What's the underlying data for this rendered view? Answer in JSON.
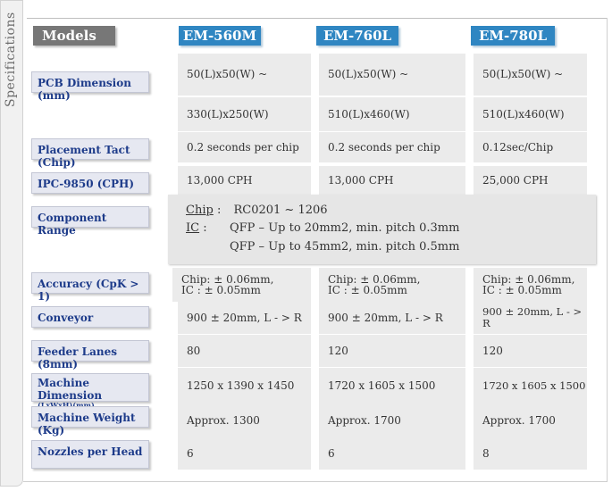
{
  "side_label": "Specifications",
  "models_label": "Models",
  "models": [
    "EM-560M",
    "EM-760L",
    "EM-780L"
  ],
  "rows": [
    {
      "label": "PCB Dimension (mm)",
      "values": [
        "50(L)x50(W) ~",
        "50(L)x50(W) ~",
        "50(L)x50(W) ~"
      ]
    },
    {
      "label": "",
      "values": [
        "330(L)x250(W)",
        "510(L)x460(W)",
        "510(L)x460(W)"
      ]
    },
    {
      "label": "Placement Tact (Chip)",
      "values": [
        "0.2 seconds per chip",
        "0.2 seconds per chip",
        "0.12sec/Chip"
      ]
    },
    {
      "label": "IPC-9850 (CPH)",
      "values": [
        "13,000 CPH",
        "13,000 CPH",
        "25,000 CPH"
      ]
    },
    {
      "label": "Component Range"
    },
    {
      "label": "Accuracy (CpK > 1)",
      "values": [
        [
          "Chip: ± 0.06mm,",
          "IC : ± 0.05mm"
        ],
        [
          "Chip: ± 0.06mm,",
          "IC : ± 0.05mm"
        ],
        [
          "Chip: ± 0.06mm,",
          "IC : ± 0.05mm"
        ]
      ]
    },
    {
      "label": "Conveyor",
      "values": [
        "900 ± 20mm, L - > R",
        "900 ± 20mm, L - > R",
        "900 ± 20mm, L - > R"
      ]
    },
    {
      "label": "Feeder Lanes (8mm)",
      "values": [
        "80",
        "120",
        "120"
      ]
    },
    {
      "label": "Machine Dimension",
      "sublabel": "(LxWxH)(mm)",
      "values": [
        "1250 x 1390 x 1450",
        "1720 x 1605 x 1500",
        "1720 x 1605 x 1500"
      ]
    },
    {
      "label": "Machine Weight (Kg)",
      "values": [
        "Approx. 1300",
        "Approx. 1700",
        "Approx. 1700"
      ]
    },
    {
      "label": "Nozzles per Head",
      "values": [
        "6",
        "6",
        "8"
      ]
    }
  ],
  "component_range": {
    "chip_label": "Chip",
    "chip_colon": " :",
    "chip_value": "RC0201 ~ 1206",
    "ic_label": "IC",
    "ic_colon": " :",
    "ic_line1": "QFP – Up to 20mm2, min. pitch 0.3mm",
    "ic_line2": "QFP – Up to 45mm2, min. pitch 0.5mm"
  }
}
